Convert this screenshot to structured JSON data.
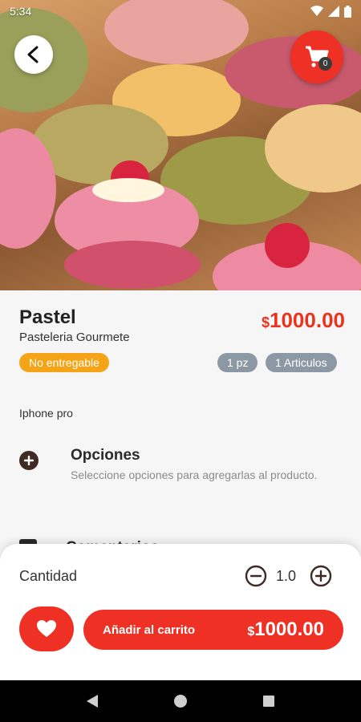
{
  "statusbar": {
    "time": "5:34"
  },
  "cart": {
    "count": "0"
  },
  "product": {
    "name": "Pastel",
    "store": "Pasteleria Gourmete",
    "price_currency": "$",
    "price_value": "1000.00",
    "delivery_badge": "No entregable",
    "unit_chip": "1 pz",
    "items_chip": "1 Articulos",
    "device_note": "Iphone pro"
  },
  "options": {
    "title": "Opciones",
    "description": "Seleccione opciones para agregarlas al producto."
  },
  "comments": {
    "title": "Comentarios"
  },
  "quantity": {
    "label": "Cantidad",
    "value": "1.0"
  },
  "add_to_cart": {
    "label": "Añadir al carrito",
    "currency": "$",
    "price": "1000.00"
  },
  "colors": {
    "accent": "#ee3124",
    "badge": "#f6a417",
    "chip": "#8d98a5"
  }
}
